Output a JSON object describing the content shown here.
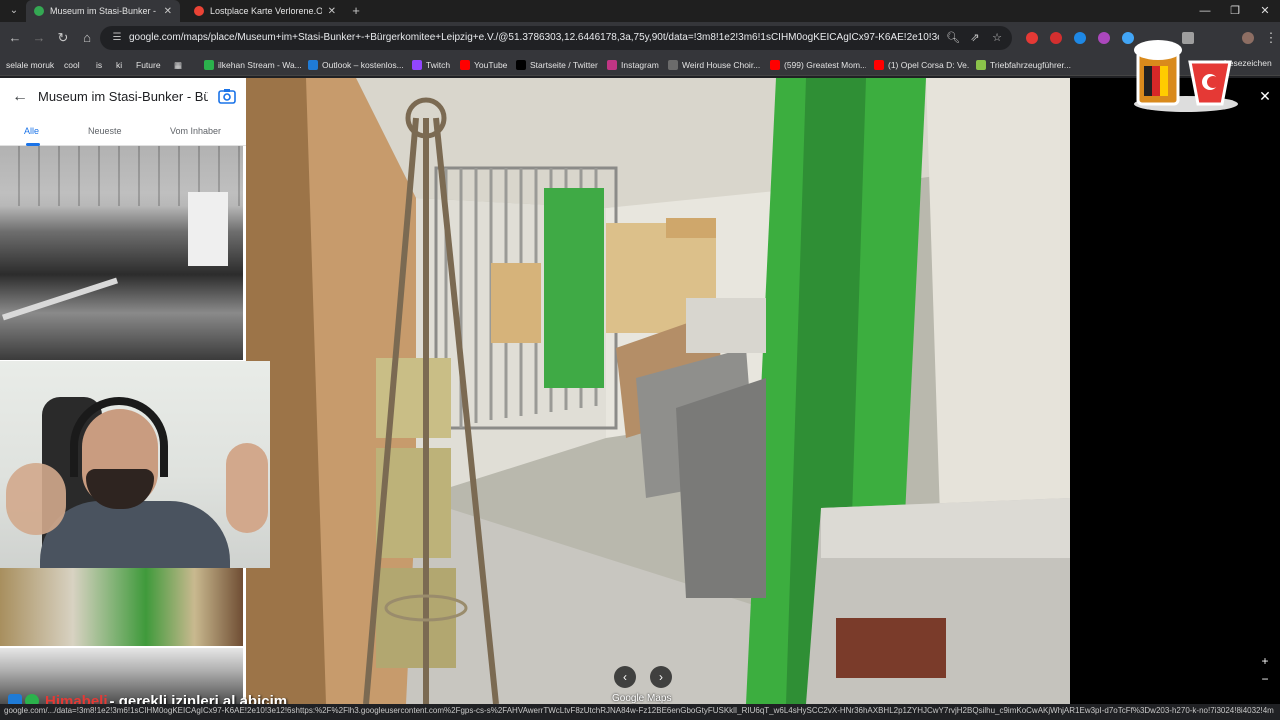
{
  "browser": {
    "tabs": [
      {
        "title": "Museum im Stasi-Bunker - Bürg",
        "favicon_color": "#34a853",
        "active": true
      },
      {
        "title": "Lostplace Karte Verlorene.Orte",
        "favicon_color": "#ea4335",
        "active": false
      }
    ],
    "url": "google.com/maps/place/Museum+im+Stasi-Bunker+-+Bürgerkomitee+Leipzig+e.V./@51.3786303,12.6446178,3a,75y,90t/data=!3m8!1e2!3m6!1sCIHM0ogKEICAgICx97-K6AE!2e10!3e12!6shttps:...",
    "bookmarks": [
      {
        "label": "selale moruk",
        "icon_color": "#3a3a3a"
      },
      {
        "label": "cool",
        "icon_color": "#3a3a3a"
      },
      {
        "label": "is",
        "icon_color": "#3a3a3a"
      },
      {
        "label": "ki",
        "icon_color": "#3a3a3a"
      },
      {
        "label": "Future",
        "icon_color": "#3a3a3a"
      },
      {
        "label": "ilkehan Stream - Wa...",
        "icon_color": "#2bb24c"
      },
      {
        "label": "Outlook – kostenlos...",
        "icon_color": "#1f7bd6"
      },
      {
        "label": "Twitch",
        "icon_color": "#9146ff"
      },
      {
        "label": "YouTube",
        "icon_color": "#ff0000"
      },
      {
        "label": "Startseite / Twitter",
        "icon_color": "#000000"
      },
      {
        "label": "Instagram",
        "icon_color": "#c13584"
      },
      {
        "label": "Weird House Choir...",
        "icon_color": "#6b6b6b"
      },
      {
        "label": "(599) Greatest Mom...",
        "icon_color": "#ff0000"
      },
      {
        "label": "(1) Opel Corsa D: Ve...",
        "icon_color": "#ff0000"
      },
      {
        "label": "Triebfahrzeugführer...",
        "icon_color": "#8bc34a"
      }
    ],
    "lesezeichen": "Lesezeichen",
    "status_url": "google.com/.../data=!3m8!1e2!3m6!1sCIHM0ogKEICAgICx97-K6AE!2e10!3e12!6shttps:%2F%2Flh3.googleusercontent.com%2Fgps-cs-s%2FAHVAwerrTWcLtvF8zUtchRJNA84w-Fz12BE6enGboGtyFUSKklI_RIU6qT_w6L4sHySCC2vX-HNr36hAXBHL2p1ZYHJCwY7rvjH2BQsilhu_c9imKoCwAKjWhjAR1Ew3pI-d7oTcFf%3Dw203-h270-k-no!7i3024!8i4032!4m11!1m..."
  },
  "panel": {
    "title": "Museum im Stasi-Bunker - Bü...",
    "tabs": [
      "Alle",
      "Neueste",
      "Vom Inhaber"
    ]
  },
  "stream": {
    "chat_name": "Himabeli",
    "chat_message": " - gerekli izinleri al abicim"
  },
  "map": {
    "logo": "Google Maps"
  }
}
